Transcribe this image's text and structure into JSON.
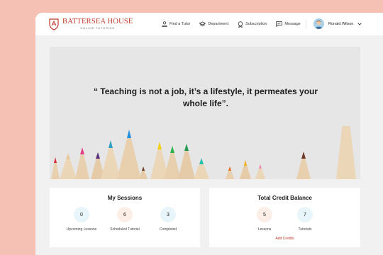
{
  "brand": {
    "name": "BATTERSEA HOUSE",
    "tagline": "ONLINE TUTORING",
    "color": "#c0392b"
  },
  "nav": [
    {
      "label": "Find a Tutor",
      "icon": "person-icon"
    },
    {
      "label": "Department",
      "icon": "graduation-cap-icon"
    },
    {
      "label": "Subscription",
      "icon": "badge-icon"
    },
    {
      "label": "Message",
      "icon": "message-icon"
    }
  ],
  "user": {
    "name": "Ronald Wilson"
  },
  "hero": {
    "quote": "“ Teaching is not a job, it’s a lifestyle, it permeates your whole life”."
  },
  "sessions": {
    "title": "My Sessions",
    "stats": [
      {
        "value": "0",
        "label": "Upcoming Lessons",
        "color": "#e8f5fb"
      },
      {
        "value": "6",
        "label": "Scheduled Tutorial",
        "color": "#fbefe8"
      },
      {
        "value": "3",
        "label": "Completed",
        "color": "#e8f5fb"
      }
    ]
  },
  "credits": {
    "title": "Total Credit Balance",
    "stats": [
      {
        "value": "5",
        "label": "Lessons",
        "color": "#fbefe8"
      },
      {
        "value": "7",
        "label": "Tutorials",
        "color": "#e8f5fb"
      }
    ],
    "add_label": "Add Credits"
  }
}
